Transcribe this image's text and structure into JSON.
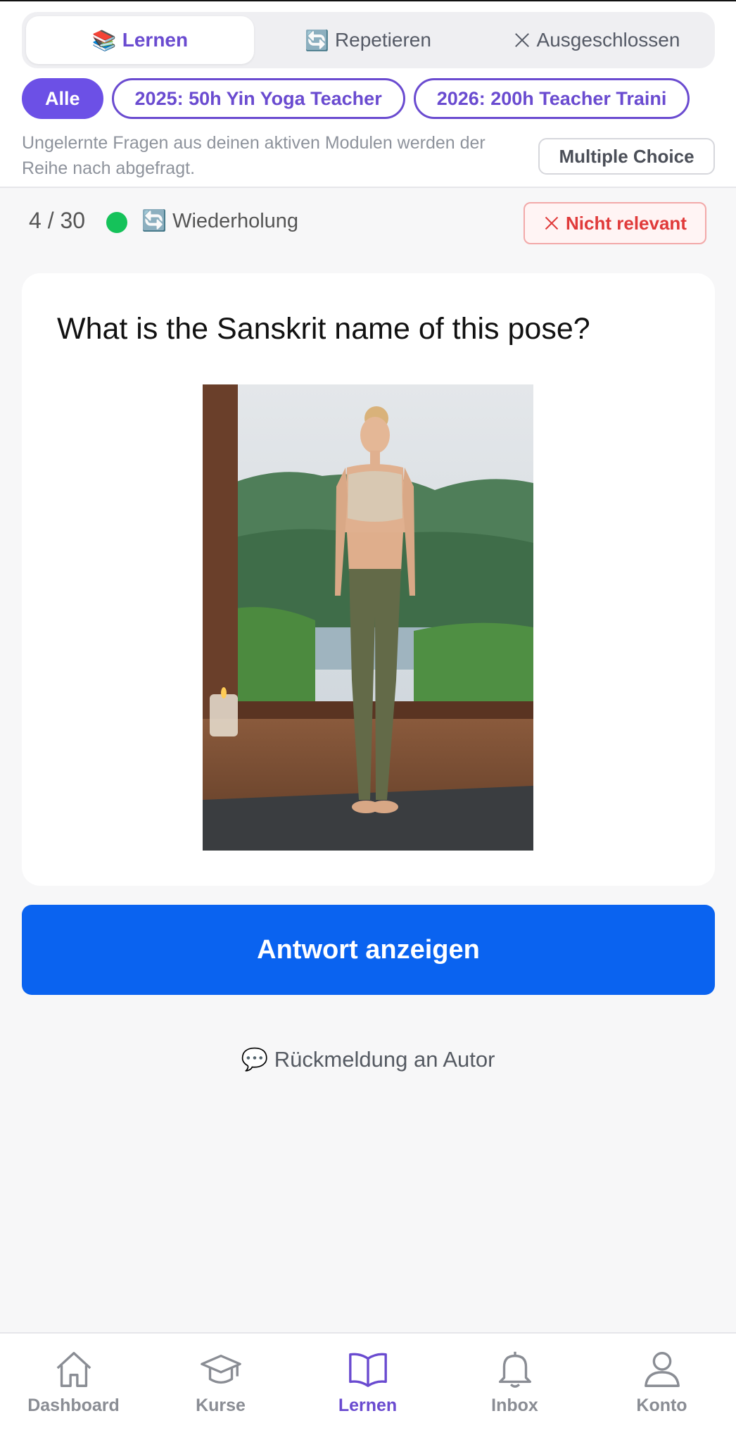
{
  "mode_tabs": {
    "learn": {
      "icon": "books-icon",
      "label": "Lernen"
    },
    "repeat": {
      "icon": "repeat-icon",
      "label": "Repetieren"
    },
    "excluded": {
      "icon": "close-icon",
      "label": "Ausgeschlossen"
    }
  },
  "filters": [
    "Alle",
    "2025: 50h Yin Yoga Teacher",
    "2026: 200h Teacher Traini"
  ],
  "hint_text": "Ungelernte Fragen aus deinen aktiven Modulen werden der Reihe nach abgefragt.",
  "multiple_choice_label": "Multiple Choice",
  "status": {
    "counter": "4 / 30",
    "state_color": "#15c25a",
    "repeat_label": "Wiederholung",
    "not_relevant_label": "Nicht relevant"
  },
  "question": "What is the Sanskrit name of this pose?",
  "answer_button": "Antwort anzeigen",
  "feedback_label": "Rückmeldung an Autor",
  "nav": [
    {
      "icon": "home-icon",
      "label": "Dashboard"
    },
    {
      "icon": "graduation-cap-icon",
      "label": "Kurse"
    },
    {
      "icon": "open-book-icon",
      "label": "Lernen"
    },
    {
      "icon": "bell-icon",
      "label": "Inbox"
    },
    {
      "icon": "user-icon",
      "label": "Konto"
    }
  ],
  "colors": {
    "accent": "#6a4bd0",
    "primary_button": "#0a63f0",
    "danger": "#e03a3a"
  }
}
